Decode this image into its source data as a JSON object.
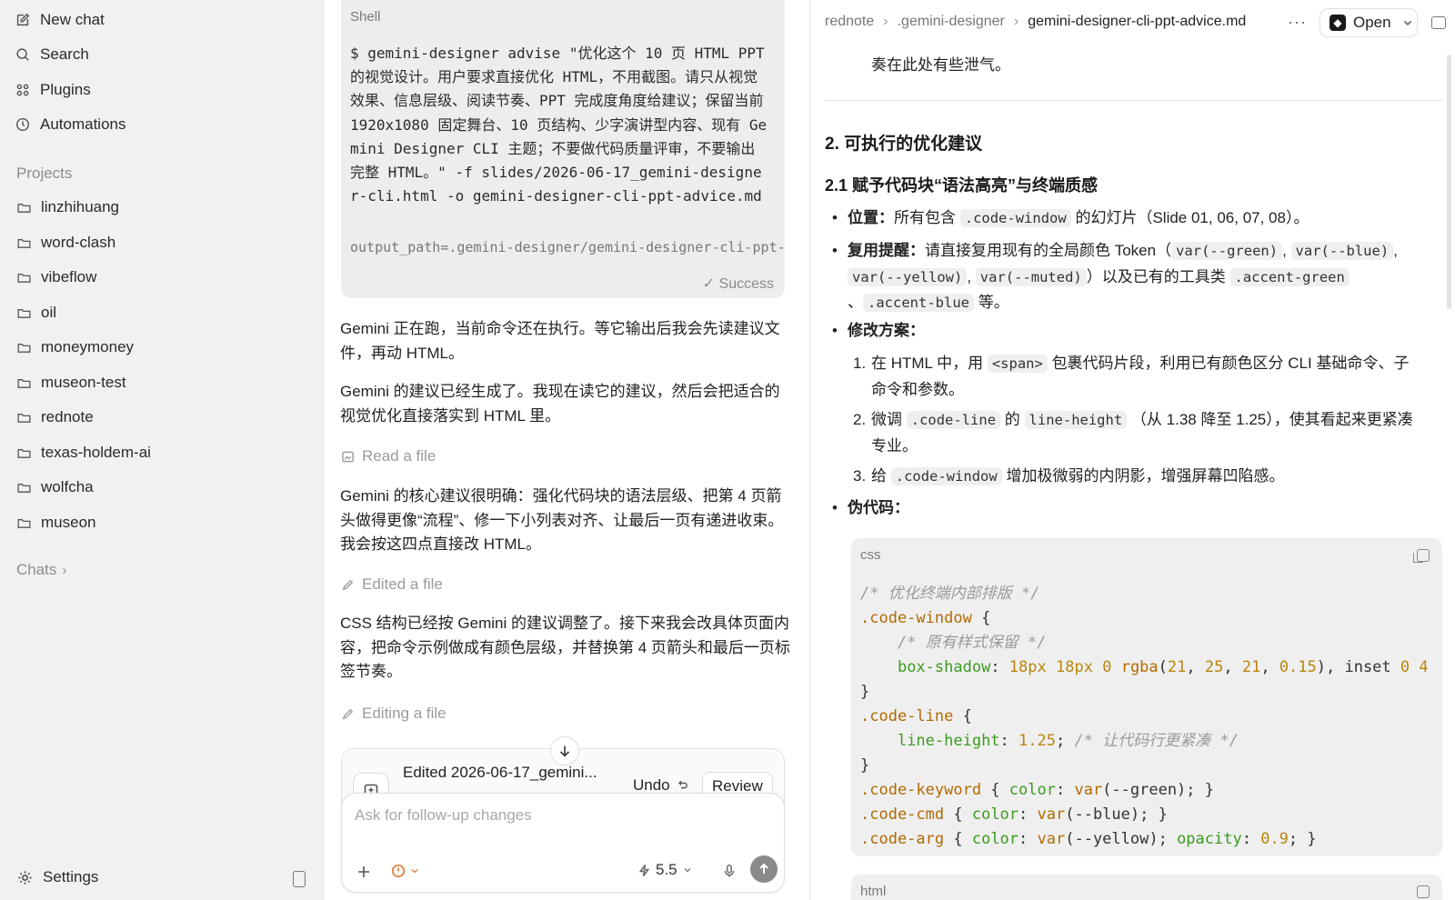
{
  "sidebar": {
    "nav": [
      {
        "label": "New chat",
        "icon": "compose-icon"
      },
      {
        "label": "Search",
        "icon": "search-icon"
      },
      {
        "label": "Plugins",
        "icon": "grid-icon"
      },
      {
        "label": "Automations",
        "icon": "clock-icon"
      }
    ],
    "projects_label": "Projects",
    "projects": [
      "linzhihuang",
      "word-clash",
      "vibeflow",
      "oil",
      "moneymoney",
      "museon-test",
      "rednote",
      "texas-holdem-ai",
      "wolfcha",
      "museon"
    ],
    "chats_label": "Chats",
    "settings_label": "Settings"
  },
  "chat": {
    "shell": {
      "title": "Shell",
      "command": "$ gemini-designer advise \"优化这个 10 页 HTML PPT 的视觉设计。用户要求直接优化 HTML，不用截图。请只从视觉效果、信息层级、阅读节奏、PPT 完成度角度给建议；保留当前 1920x1080 固定舞台、10 页结构、少字演讲型内容、现有 Gemini Designer CLI 主题；不要做代码质量评审，不要输出完整 HTML。\" -f slides/2026-06-17_gemini-designer-cli.html -o gemini-designer-cli-ppt-advice.md",
      "output": "output_path=.gemini-designer/gemini-designer-cli-ppt-advice.md",
      "status": "✓ Success"
    },
    "messages": [
      "Gemini 正在跑，当前命令还在执行。等它输出后我会先读建议文件，再动 HTML。",
      "Gemini 的建议已经生成了。我现在读它的建议，然后会把适合的视觉优化直接落实到 HTML 里。",
      "Gemini 的核心建议很明确：强化代码块的语法层级、把第 4 页箭头做得更像“流程”、修一下小列表对齐、让最后一页有递进收束。我会按这四点直接改 HTML。",
      "CSS 结构已经按 Gemini 的建议调整了。接下来我会改具体页面内容，把命令示例做成有颜色层级，并替换第 4 页箭头和最后一页标签节奏。"
    ],
    "tools": {
      "read": "Read a file",
      "edited": "Edited a file",
      "editing": "Editing a file"
    },
    "edited_card": {
      "text": "Edited 2026-06-17_gemini...",
      "undo": "Undo",
      "review": "Review"
    },
    "composer": {
      "placeholder": "Ask for follow-up changes",
      "model": "5.5",
      "warn_color": "#e07b39"
    }
  },
  "doc": {
    "breadcrumb": [
      "rednote",
      ".gemini-designer",
      "gemini-designer-cli-ppt-advice.md"
    ],
    "more": "···",
    "open_label": "Open",
    "prev_text": "奏在此处有些泄气。",
    "h2": "2. 可执行的优化建议",
    "h3": "2.1 赋予代码块“语法高亮”与终端质感",
    "bullet_position": {
      "label": "位置：",
      "pre": "所有包含",
      "code": ".code-window",
      "post": "的幻灯片（Slide 01, 06, 07, 08）。"
    },
    "bullet_reuse": {
      "label": "复用提醒：",
      "pre": "请直接复用现有的全局颜色 Token（",
      "c1": "var(--green)",
      "c2": "var(--blue)",
      "c3": "var(--yellow)",
      "c4": "var(--muted)",
      "mid": "）以及已有的工具类",
      "c5": ".accent-green",
      "c6": ".accent-blue",
      "post": "等。"
    },
    "bullet_plan_label": "修改方案：",
    "steps": [
      {
        "num": "1.",
        "pre": "在 HTML 中，用",
        "code": "<span>",
        "post": "包裹代码片段，利用已有颜色区分 CLI 基础命令、子命令和参数。"
      },
      {
        "num": "2.",
        "pre": "微调",
        "code": ".code-line",
        "mid": "的",
        "code2": "line-height",
        "post": "（从 1.38 降至 1.25），使其看起来更紧凑专业。"
      },
      {
        "num": "3.",
        "pre": "给",
        "code": ".code-window",
        "post": "增加极微弱的内阴影，增强屏幕凹陷感。"
      }
    ],
    "bullet_pseudo_label": "伪代码：",
    "css_label": "css",
    "html_label": "html"
  }
}
